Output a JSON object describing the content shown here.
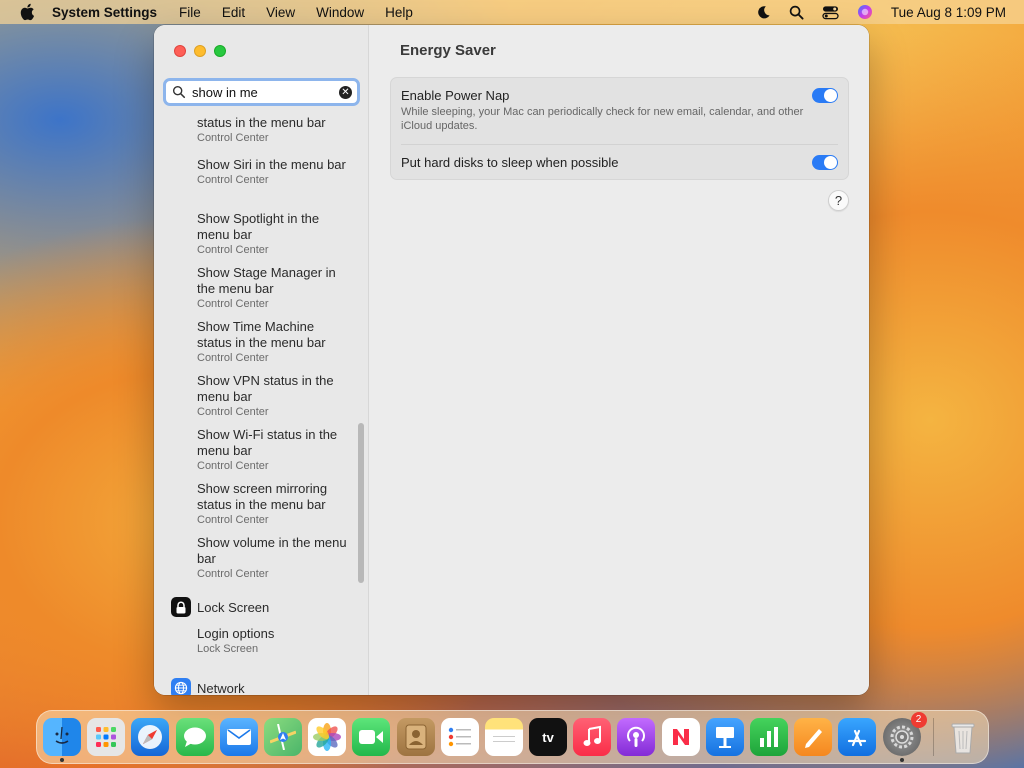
{
  "menubar": {
    "app_name": "System Settings",
    "menus": [
      "File",
      "Edit",
      "View",
      "Window",
      "Help"
    ],
    "clock": "Tue Aug 8  1:09 PM",
    "status_icons": [
      "focus-moon-icon",
      "spotlight-search-icon",
      "control-center-icon",
      "siri-icon"
    ]
  },
  "sidebar": {
    "search": {
      "value": "show in me",
      "placeholder": "Search"
    },
    "results": [
      {
        "title": "status in the menu bar",
        "sub": "Control Center"
      },
      {
        "title": "Show Siri in the menu bar",
        "sub": "Control Center"
      },
      {
        "title": "Show Spotlight in the menu bar",
        "sub": "Control Center"
      },
      {
        "title": "Show Stage Manager in the menu bar",
        "sub": "Control Center"
      },
      {
        "title": "Show Time Machine status in the menu bar",
        "sub": "Control Center"
      },
      {
        "title": "Show VPN status in the menu bar",
        "sub": "Control Center"
      },
      {
        "title": "Show Wi-Fi status in the menu bar",
        "sub": "Control Center"
      },
      {
        "title": "Show screen mirroring status in the menu bar",
        "sub": "Control Center"
      },
      {
        "title": "Show volume in the menu bar",
        "sub": "Control Center"
      }
    ],
    "sections": [
      {
        "label": "Lock Screen",
        "icon": "lock-icon"
      },
      {
        "label": "Network",
        "icon": "globe-icon"
      }
    ],
    "lock_screen_result": {
      "title": "Login options",
      "sub": "Lock Screen"
    }
  },
  "content": {
    "title": "Energy Saver",
    "settings": [
      {
        "label": "Enable Power Nap",
        "description": "While sleeping, your Mac can periodically check for new email, calendar, and other iCloud updates.",
        "enabled": true
      },
      {
        "label": "Put hard disks to sleep when possible",
        "description": "",
        "enabled": true
      }
    ],
    "help_label": "?"
  },
  "dock": {
    "apps": [
      {
        "name": "Finder",
        "icon": "finder-icon",
        "color": "#3e9bf0",
        "running": true
      },
      {
        "name": "Launchpad",
        "icon": "launchpad-icon",
        "color": "#e9e9e9",
        "running": false
      },
      {
        "name": "Safari",
        "icon": "safari-icon",
        "color": "#1e8ef0",
        "running": false
      },
      {
        "name": "Messages",
        "icon": "messages-icon",
        "color": "#35c759",
        "running": false
      },
      {
        "name": "Mail",
        "icon": "mail-icon",
        "color": "#2e8cf3",
        "running": false
      },
      {
        "name": "Maps",
        "icon": "maps-icon",
        "color": "#6ac56b",
        "running": false
      },
      {
        "name": "Photos",
        "icon": "photos-icon",
        "color": "#ffffff",
        "running": false
      },
      {
        "name": "FaceTime",
        "icon": "facetime-icon",
        "color": "#2fc95a",
        "running": false
      },
      {
        "name": "Contacts",
        "icon": "contacts-icon",
        "color": "#b88a52",
        "running": false
      },
      {
        "name": "Reminders",
        "icon": "reminders-icon",
        "color": "#ffffff",
        "running": false
      },
      {
        "name": "Notes",
        "icon": "notes-icon",
        "color": "#ffd33d",
        "running": false
      },
      {
        "name": "TV",
        "icon": "apple-tv-icon",
        "color": "#111111",
        "running": false,
        "label": "tv"
      },
      {
        "name": "Music",
        "icon": "music-icon",
        "color": "#fb3b52",
        "running": false
      },
      {
        "name": "Podcasts",
        "icon": "podcasts-icon",
        "color": "#9b4de3",
        "running": false
      },
      {
        "name": "News",
        "icon": "news-icon",
        "color": "#ffffff",
        "running": false
      },
      {
        "name": "Keynote",
        "icon": "keynote-icon",
        "color": "#2b8ef0",
        "running": false
      },
      {
        "name": "Numbers",
        "icon": "numbers-icon",
        "color": "#33b84a",
        "running": false
      },
      {
        "name": "Pages",
        "icon": "pages-icon",
        "color": "#f59a27",
        "running": false
      },
      {
        "name": "App Store",
        "icon": "app-store-icon",
        "color": "#1f8ff0",
        "running": false
      },
      {
        "name": "System Settings",
        "icon": "system-settings-icon",
        "color": "#8a8a8a",
        "running": true,
        "badge": "2"
      }
    ],
    "trash": {
      "name": "Trash",
      "icon": "trash-icon"
    }
  }
}
